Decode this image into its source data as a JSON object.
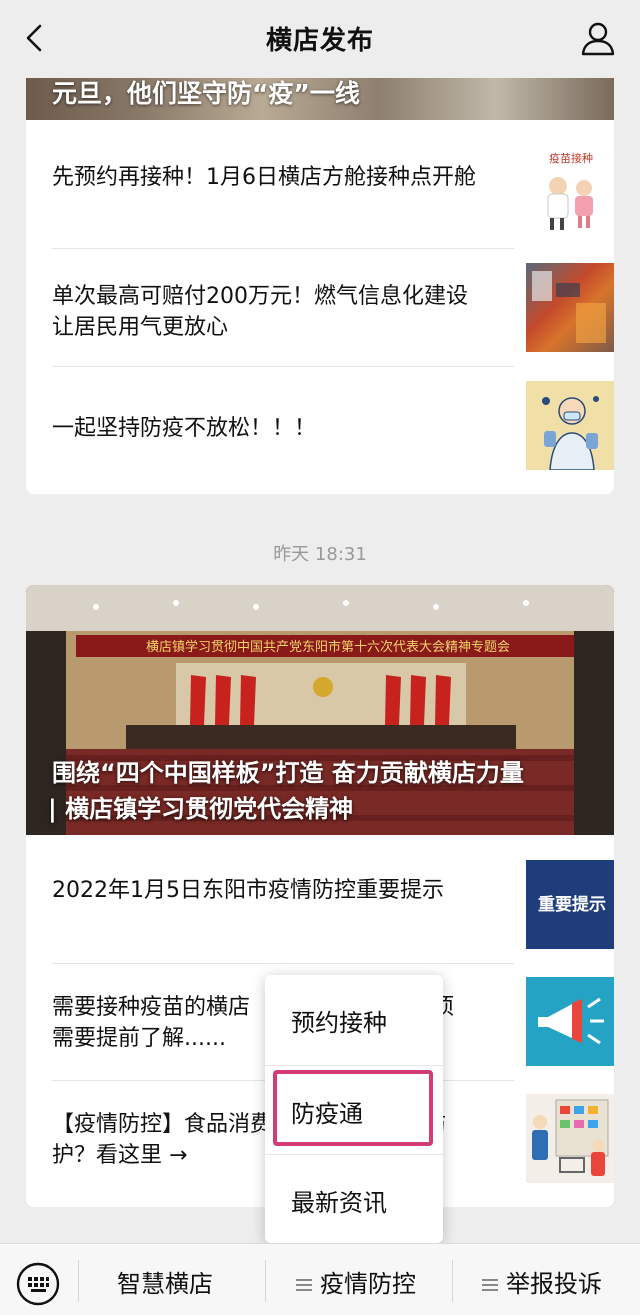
{
  "header": {
    "title": "横店发布"
  },
  "card1": {
    "banner_text": "元旦，他们坚守防“疫”一线",
    "items": [
      {
        "text": "先预约再接种！1月6日横店方舱接种点开舱",
        "thumb_text": "疫苗接种"
      },
      {
        "text": "单次最高可赔付200万元！燃气信息化建设让居民用气更放心"
      },
      {
        "text": "一起坚持防疫不放松！！！"
      }
    ]
  },
  "timestamp": "昨天 18:31",
  "card2": {
    "hero_banner": "横店镇学习贯彻中国共产党东阳市第十六次代表大会精神专题会",
    "hero_title_line1": "围绕“四个中国样板”打造 奋力贡献横店力量",
    "hero_title_line2": "| 横店镇学习贯彻党代会精神",
    "items": [
      {
        "text": "2022年1月5日东阳市疫情防控重要提示",
        "thumb_text": "重要提示"
      },
      {
        "text": "需要接种疫苗的横店居民，这些事项需要提前了解......",
        "visible_line1": "需要接种疫苗的横店",
        "visible_line1_end": "事项",
        "visible_line2": "需要提前了解......"
      },
      {
        "text": "【疫情防控】食品消费，如何防护？看这里 →",
        "visible_line1": "【疫情防控】食品消费",
        "visible_line1_end": "防",
        "visible_line2": "护？看这里 →"
      }
    ]
  },
  "popup_menu": {
    "items": [
      "预约接种",
      "防疫通",
      "最新资讯"
    ],
    "highlighted": "防疫通",
    "highlight_color": "#d33b76"
  },
  "tabbar": {
    "tabs": [
      "智慧横店",
      "疫情防控",
      "举报投诉"
    ]
  }
}
